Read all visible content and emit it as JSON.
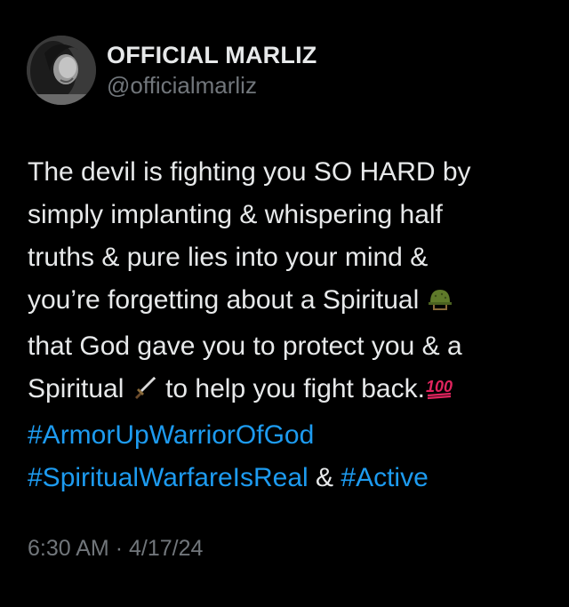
{
  "user": {
    "display_name": "OFFICIAL MARLIZ",
    "handle": "@officialmarliz",
    "avatar_icon": "profile-photo"
  },
  "tweet": {
    "lines": [
      "The devil is fighting you SO HARD by",
      "simply implanting & whispering half",
      "truths & pure lies into your mind &",
      "you’re forgetting about a Spiritual",
      "that God gave you to protect you & a",
      "Spiritual",
      "to help you fight back."
    ],
    "emojis": {
      "helmet": "military-helmet-emoji",
      "sword": "dagger-emoji",
      "hundred": "hundred-points-emoji"
    },
    "hashtags": [
      "#ArmorUpWarriorOfGod",
      "#SpiritualWarfareIsReal",
      "#Active"
    ],
    "connector": "&"
  },
  "meta": {
    "time": "6:30 AM",
    "separator": "·",
    "date": "4/17/24"
  },
  "colors": {
    "background": "#000000",
    "text": "#e7e9ea",
    "secondary": "#71767b",
    "link": "#1d9bf0"
  }
}
